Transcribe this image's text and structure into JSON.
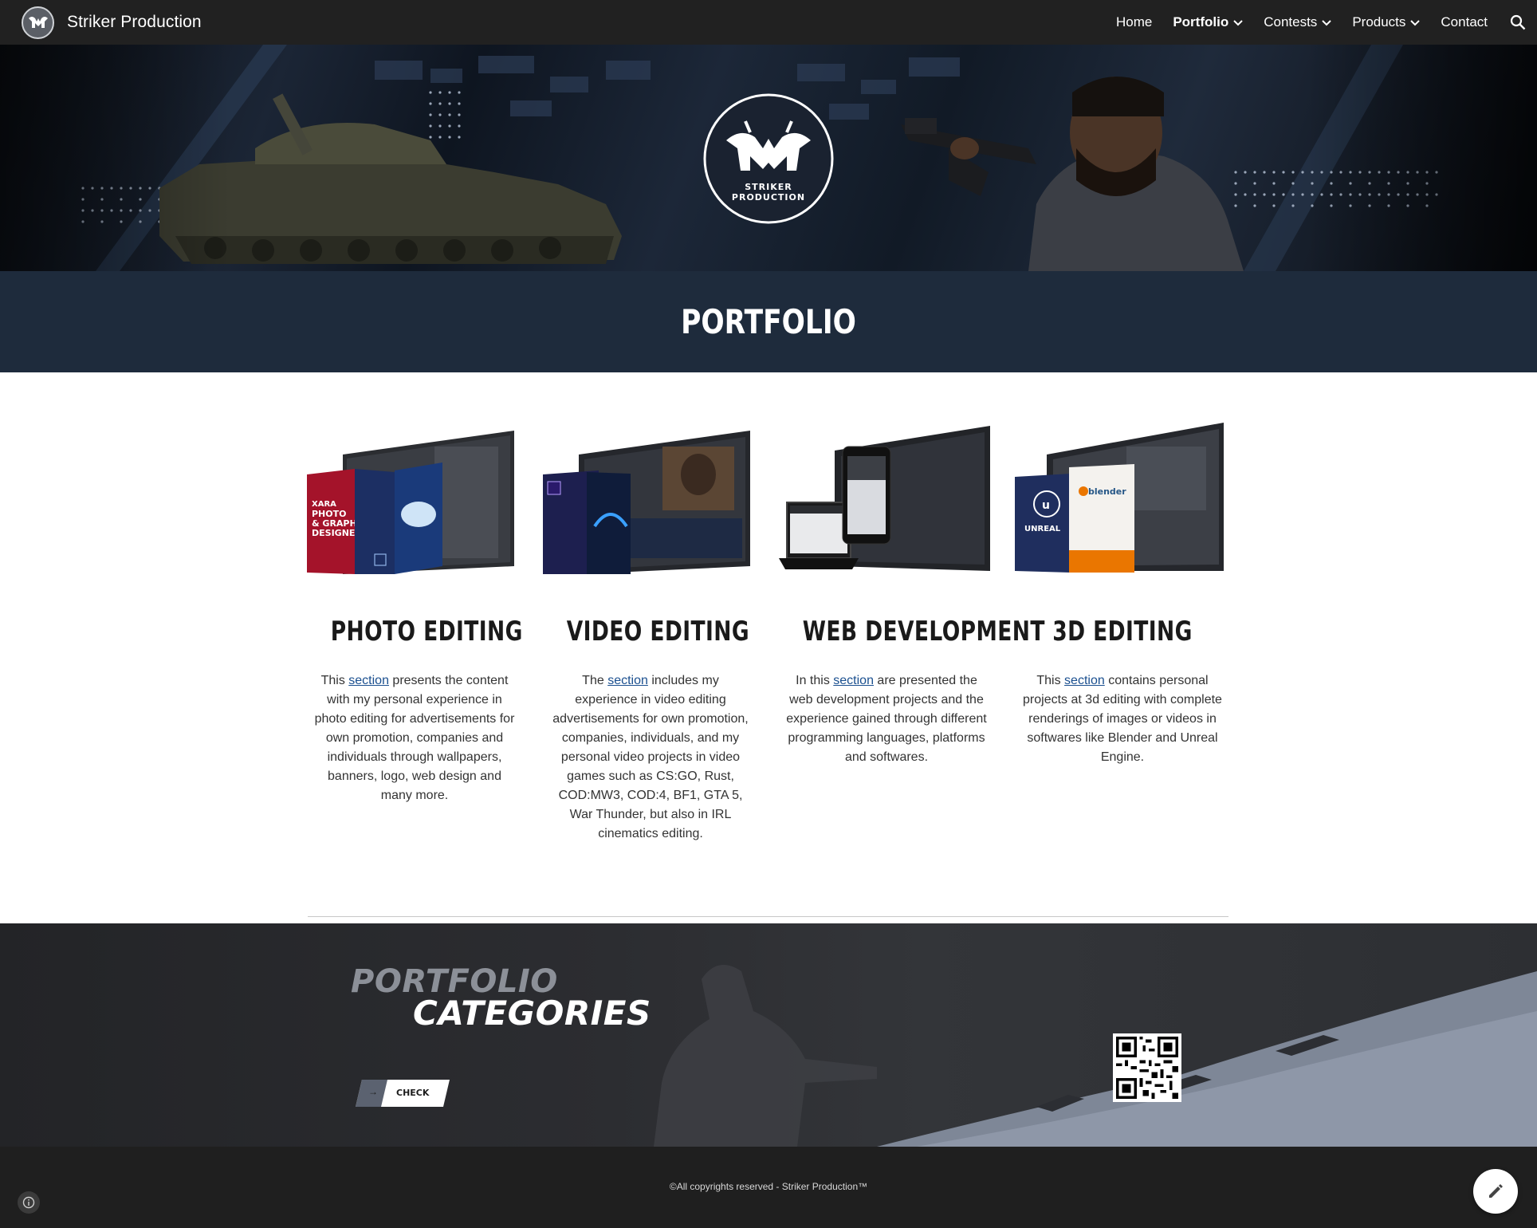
{
  "site": {
    "title": "Striker Production"
  },
  "nav": {
    "items": [
      {
        "label": "Home",
        "has_dropdown": false,
        "active": false
      },
      {
        "label": "Portfolio",
        "has_dropdown": true,
        "active": true
      },
      {
        "label": "Contests",
        "has_dropdown": true,
        "active": false
      },
      {
        "label": "Products",
        "has_dropdown": true,
        "active": false
      },
      {
        "label": "Contact",
        "has_dropdown": false,
        "active": false
      }
    ],
    "search_icon": "search-icon"
  },
  "hero": {
    "logo_text_line1": "STRIKER",
    "logo_text_line2": "PRODUCTION"
  },
  "page": {
    "heading": "PORTFOLIO"
  },
  "cards": [
    {
      "title": "PHOTO EDITING",
      "desc_before": "This ",
      "link": "section",
      "desc_after": " presents the content with my personal experience in photo editing for advertisements for own promotion, companies and individuals through wallpapers, banners, logo, web design and many more.",
      "image_box_text": "XARA PHOTO & GRAPHIC DESIGNER"
    },
    {
      "title": "VIDEO EDITING",
      "desc_before": "The ",
      "link": "section",
      "desc_after": " includes my experience in video editing advertisements for own promotion, companies, individuals, and my personal video projects in video games such as CS:GO, Rust, COD:MW3, COD:4, BF1, GTA 5, War Thunder, but also in IRL cinematics editing."
    },
    {
      "title": "WEB DEVELOPMENT",
      "desc_before": "In this ",
      "link": "section",
      "desc_after": " are presented the web development projects and the experience gained through different programming languages, platforms and softwares."
    },
    {
      "title": "3D EDITING",
      "desc_before": "This ",
      "link": "section",
      "desc_after": " contains personal projects at 3d editing with complete renderings of images or videos in softwares like Blender and Unreal Engine.",
      "image_box_text_1": "UNREAL",
      "image_box_text_2": "blender"
    }
  ],
  "categories_banner": {
    "title_line1": "PORTFOLIO",
    "title_line2": "CATEGORIES",
    "button_label": "CHECK",
    "button_arrow": "→"
  },
  "footer": {
    "copyright": "©All copyrights reserved - Striker Production™"
  },
  "colors": {
    "nav_bg": "#212121",
    "title_band_bg": "#1e2b3c",
    "link": "#1a4f8f",
    "footer_bg": "#1f1f1f"
  }
}
